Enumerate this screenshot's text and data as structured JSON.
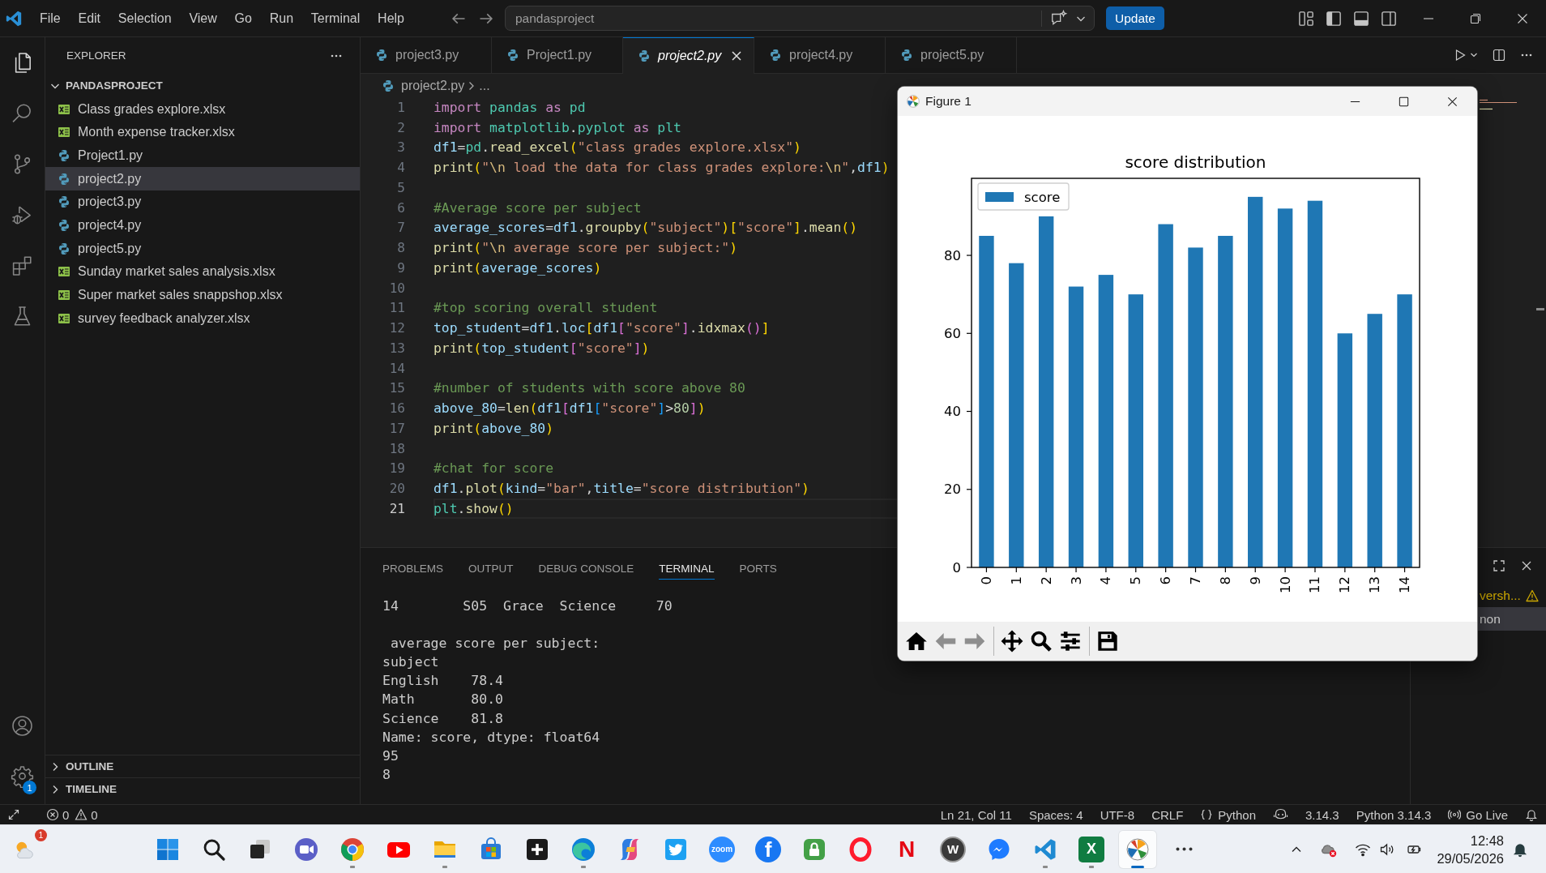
{
  "title_bar": {
    "menu": [
      "File",
      "Edit",
      "Selection",
      "View",
      "Go",
      "Run",
      "Terminal",
      "Help"
    ],
    "search": {
      "value": "pandasproject"
    },
    "update_button": "Update"
  },
  "activity_bar": {
    "items": [
      {
        "kind": "explorer",
        "selected": true
      },
      {
        "kind": "search",
        "selected": false
      },
      {
        "kind": "source-control",
        "selected": false
      },
      {
        "kind": "run-debug",
        "selected": false
      },
      {
        "kind": "extensions",
        "selected": false
      },
      {
        "kind": "testing",
        "selected": false
      }
    ],
    "bottom_items": [
      {
        "kind": "accounts"
      },
      {
        "kind": "manage",
        "badge": "1"
      }
    ]
  },
  "sidebar": {
    "title": "EXPLORER",
    "folder": {
      "name": "PANDASPROJECT",
      "expanded": true,
      "files": [
        {
          "name": "Class grades explore.xlsx",
          "kind": "excel",
          "selected": false
        },
        {
          "name": "Month expense tracker.xlsx",
          "kind": "excel",
          "selected": false
        },
        {
          "name": "Project1.py",
          "kind": "python",
          "selected": false
        },
        {
          "name": "project2.py",
          "kind": "python",
          "selected": true
        },
        {
          "name": "project3.py",
          "kind": "python",
          "selected": false
        },
        {
          "name": "project4.py",
          "kind": "python",
          "selected": false
        },
        {
          "name": "project5.py",
          "kind": "python",
          "selected": false
        },
        {
          "name": "Sunday market sales analysis.xlsx",
          "kind": "excel",
          "selected": false
        },
        {
          "name": "Super market sales snappshop.xlsx",
          "kind": "excel",
          "selected": false
        },
        {
          "name": "survey feedback analyzer.xlsx",
          "kind": "excel",
          "selected": false
        }
      ]
    },
    "sections": [
      {
        "name": "OUTLINE",
        "expanded": false
      },
      {
        "name": "TIMELINE",
        "expanded": false
      }
    ]
  },
  "editor": {
    "tabs": [
      {
        "label": "project3.py",
        "selected": false,
        "preview": false
      },
      {
        "label": "Project1.py",
        "selected": false,
        "preview": false
      },
      {
        "label": "project2.py",
        "selected": true,
        "preview": true
      },
      {
        "label": "project4.py",
        "selected": false,
        "preview": false
      },
      {
        "label": "project5.py",
        "selected": false,
        "preview": false
      }
    ],
    "breadcrumb": [
      "project2.py",
      "..."
    ],
    "lines": [
      {
        "number": "1",
        "current": false,
        "tokens": [
          {
            "kind": "keyword",
            "text": "import "
          },
          {
            "kind": "module",
            "text": "pandas "
          },
          {
            "kind": "keyword",
            "text": "as "
          },
          {
            "kind": "module",
            "text": "pd"
          }
        ]
      },
      {
        "number": "2",
        "current": false,
        "tokens": [
          {
            "kind": "keyword",
            "text": "import "
          },
          {
            "kind": "module",
            "text": "matplotlib"
          },
          {
            "kind": "plain",
            "text": "."
          },
          {
            "kind": "module",
            "text": "pyplot "
          },
          {
            "kind": "keyword",
            "text": "as "
          },
          {
            "kind": "module",
            "text": "plt"
          }
        ]
      },
      {
        "number": "3",
        "current": false,
        "tokens": [
          {
            "kind": "variable",
            "text": "df1"
          },
          {
            "kind": "plain",
            "text": "="
          },
          {
            "kind": "module",
            "text": "pd"
          },
          {
            "kind": "plain",
            "text": "."
          },
          {
            "kind": "function",
            "text": "read_excel"
          },
          {
            "kind": "bracket1",
            "text": "("
          },
          {
            "kind": "string",
            "text": "\"class grades explore.xlsx\""
          },
          {
            "kind": "bracket1",
            "text": ")"
          }
        ]
      },
      {
        "number": "4",
        "current": false,
        "tokens": [
          {
            "kind": "function",
            "text": "print"
          },
          {
            "kind": "bracket1",
            "text": "("
          },
          {
            "kind": "string",
            "text": "\""
          },
          {
            "kind": "escape",
            "text": "\\n"
          },
          {
            "kind": "string",
            "text": " load the data for class grades explore:"
          },
          {
            "kind": "escape",
            "text": "\\n"
          },
          {
            "kind": "string",
            "text": "\""
          },
          {
            "kind": "plain",
            "text": ","
          },
          {
            "kind": "variable",
            "text": "df1"
          },
          {
            "kind": "bracket1",
            "text": ")"
          }
        ]
      },
      {
        "number": "5",
        "current": false
      },
      {
        "number": "6",
        "current": false,
        "tokens": [
          {
            "kind": "comment",
            "text": "#Average score per subject"
          }
        ]
      },
      {
        "number": "7",
        "current": false,
        "tokens": [
          {
            "kind": "variable",
            "text": "average_scores"
          },
          {
            "kind": "plain",
            "text": "="
          },
          {
            "kind": "variable",
            "text": "df1"
          },
          {
            "kind": "plain",
            "text": "."
          },
          {
            "kind": "function",
            "text": "groupby"
          },
          {
            "kind": "bracket1",
            "text": "("
          },
          {
            "kind": "string",
            "text": "\"subject\""
          },
          {
            "kind": "bracket1",
            "text": ")["
          },
          {
            "kind": "string",
            "text": "\"score\""
          },
          {
            "kind": "bracket1",
            "text": "]"
          },
          {
            "kind": "plain",
            "text": "."
          },
          {
            "kind": "function",
            "text": "mean"
          },
          {
            "kind": "bracket1",
            "text": "()"
          }
        ]
      },
      {
        "number": "8",
        "current": false,
        "tokens": [
          {
            "kind": "function",
            "text": "print"
          },
          {
            "kind": "bracket1",
            "text": "("
          },
          {
            "kind": "string",
            "text": "\""
          },
          {
            "kind": "escape",
            "text": "\\n"
          },
          {
            "kind": "string",
            "text": " average score per subject:\""
          },
          {
            "kind": "bracket1",
            "text": ")"
          }
        ]
      },
      {
        "number": "9",
        "current": false,
        "tokens": [
          {
            "kind": "function",
            "text": "print"
          },
          {
            "kind": "bracket1",
            "text": "("
          },
          {
            "kind": "variable",
            "text": "average_scores"
          },
          {
            "kind": "bracket1",
            "text": ")"
          }
        ]
      },
      {
        "number": "10",
        "current": false
      },
      {
        "number": "11",
        "current": false,
        "tokens": [
          {
            "kind": "comment",
            "text": "#top scoring overall student"
          }
        ]
      },
      {
        "number": "12",
        "current": false,
        "tokens": [
          {
            "kind": "variable",
            "text": "top_student"
          },
          {
            "kind": "plain",
            "text": "="
          },
          {
            "kind": "variable",
            "text": "df1"
          },
          {
            "kind": "plain",
            "text": "."
          },
          {
            "kind": "variable",
            "text": "loc"
          },
          {
            "kind": "bracket1",
            "text": "["
          },
          {
            "kind": "variable",
            "text": "df1"
          },
          {
            "kind": "bracket2",
            "text": "["
          },
          {
            "kind": "string",
            "text": "\"score\""
          },
          {
            "kind": "bracket2",
            "text": "]"
          },
          {
            "kind": "plain",
            "text": "."
          },
          {
            "kind": "function",
            "text": "idxmax"
          },
          {
            "kind": "bracket2",
            "text": "()"
          },
          {
            "kind": "bracket1",
            "text": "]"
          }
        ]
      },
      {
        "number": "13",
        "current": false,
        "tokens": [
          {
            "kind": "function",
            "text": "print"
          },
          {
            "kind": "bracket1",
            "text": "("
          },
          {
            "kind": "variable",
            "text": "top_student"
          },
          {
            "kind": "bracket2",
            "text": "["
          },
          {
            "kind": "string",
            "text": "\"score\""
          },
          {
            "kind": "bracket2",
            "text": "]"
          },
          {
            "kind": "bracket1",
            "text": ")"
          }
        ]
      },
      {
        "number": "14",
        "current": false
      },
      {
        "number": "15",
        "current": false,
        "tokens": [
          {
            "kind": "comment",
            "text": "#number of students with score above 80"
          }
        ]
      },
      {
        "number": "16",
        "current": false,
        "tokens": [
          {
            "kind": "variable",
            "text": "above_80"
          },
          {
            "kind": "plain",
            "text": "="
          },
          {
            "kind": "function",
            "text": "len"
          },
          {
            "kind": "bracket1",
            "text": "("
          },
          {
            "kind": "variable",
            "text": "df1"
          },
          {
            "kind": "bracket2",
            "text": "["
          },
          {
            "kind": "variable",
            "text": "df1"
          },
          {
            "kind": "bracket3",
            "text": "["
          },
          {
            "kind": "string",
            "text": "\"score\""
          },
          {
            "kind": "bracket3",
            "text": "]"
          },
          {
            "kind": "plain",
            "text": ">"
          },
          {
            "kind": "number",
            "text": "80"
          },
          {
            "kind": "bracket2",
            "text": "]"
          },
          {
            "kind": "bracket1",
            "text": ")"
          }
        ]
      },
      {
        "number": "17",
        "current": false,
        "tokens": [
          {
            "kind": "function",
            "text": "print"
          },
          {
            "kind": "bracket1",
            "text": "("
          },
          {
            "kind": "variable",
            "text": "above_80"
          },
          {
            "kind": "bracket1",
            "text": ")"
          }
        ]
      },
      {
        "number": "18",
        "current": false
      },
      {
        "number": "19",
        "current": false,
        "tokens": [
          {
            "kind": "comment",
            "text": "#chat for score"
          }
        ]
      },
      {
        "number": "20",
        "current": false,
        "tokens": [
          {
            "kind": "variable",
            "text": "df1"
          },
          {
            "kind": "plain",
            "text": "."
          },
          {
            "kind": "function",
            "text": "plot"
          },
          {
            "kind": "bracket1",
            "text": "("
          },
          {
            "kind": "variable",
            "text": "kind"
          },
          {
            "kind": "plain",
            "text": "="
          },
          {
            "kind": "string",
            "text": "\"bar\""
          },
          {
            "kind": "plain",
            "text": ","
          },
          {
            "kind": "variable",
            "text": "title"
          },
          {
            "kind": "plain",
            "text": "="
          },
          {
            "kind": "string",
            "text": "\"score distribution\""
          },
          {
            "kind": "bracket1",
            "text": ")"
          }
        ]
      },
      {
        "number": "21",
        "current": true,
        "tokens": [
          {
            "kind": "module",
            "text": "plt"
          },
          {
            "kind": "plain",
            "text": "."
          },
          {
            "kind": "function",
            "text": "show"
          },
          {
            "kind": "bracket1",
            "text": "()"
          }
        ]
      }
    ]
  },
  "panel": {
    "tabs": [
      {
        "label": "PROBLEMS",
        "selected": false
      },
      {
        "label": "OUTPUT",
        "selected": false
      },
      {
        "label": "DEBUG CONSOLE",
        "selected": false
      },
      {
        "label": "TERMINAL",
        "selected": true
      },
      {
        "label": "PORTS",
        "selected": false
      }
    ],
    "terminal_blocks": [
      [
        "14        S05  Grace  Science     70"
      ],
      [
        " average score per subject:",
        "subject",
        "English    78.4",
        "Math       80.0",
        "Science    81.8",
        "Name: score, dtype: float64",
        "95",
        "8"
      ]
    ],
    "terminals": [
      {
        "label": "versh...",
        "warning": true,
        "selected": false
      },
      {
        "label": "non",
        "warning": false,
        "selected": true
      }
    ]
  },
  "figure": {
    "title": "Figure 1",
    "chart_data": {
      "type": "bar",
      "title": "score distribution",
      "categories": [
        "0",
        "1",
        "2",
        "3",
        "4",
        "5",
        "6",
        "7",
        "8",
        "9",
        "10",
        "11",
        "12",
        "13",
        "14"
      ],
      "series": [
        {
          "name": "score",
          "color": "#1f77b4",
          "values": [
            85,
            78,
            90,
            72,
            75,
            70,
            88,
            82,
            85,
            95,
            92,
            94,
            60,
            65,
            70
          ]
        }
      ],
      "ylim": [
        0,
        99.75
      ],
      "yticks": [
        0,
        20,
        40,
        60,
        80
      ]
    },
    "toolbar": [
      [
        {
          "kind": "home",
          "disabled": false
        },
        {
          "kind": "back",
          "disabled": true
        },
        {
          "kind": "forward",
          "disabled": true
        }
      ],
      [
        {
          "kind": "move",
          "disabled": false
        },
        {
          "kind": "zoom",
          "disabled": false
        },
        {
          "kind": "configure",
          "disabled": false
        }
      ],
      [
        {
          "kind": "save",
          "disabled": false
        }
      ]
    ]
  },
  "status_bar": {
    "problems": [
      {
        "kind": "error",
        "count": "0"
      },
      {
        "kind": "warning",
        "count": "0"
      }
    ],
    "items": [
      {
        "kind": "text",
        "label": "Ln 21, Col 11"
      },
      {
        "kind": "text",
        "label": "Spaces: 4"
      },
      {
        "kind": "text",
        "label": "UTF-8"
      },
      {
        "kind": "text",
        "label": "CRLF"
      },
      {
        "kind": "language",
        "label": "Python"
      },
      {
        "kind": "copilot"
      },
      {
        "kind": "text",
        "label": "3.14.3"
      },
      {
        "kind": "text",
        "label": "Python 3.14.3"
      },
      {
        "kind": "live",
        "label": "Go Live"
      },
      {
        "kind": "bell"
      }
    ]
  },
  "taskbar": {
    "weather": {
      "badge": "1"
    },
    "apps": [
      {
        "kind": "windows",
        "running": false,
        "selected": false
      },
      {
        "kind": "search",
        "running": false,
        "selected": false
      },
      {
        "kind": "task-view",
        "running": false,
        "selected": false
      },
      {
        "kind": "video-call",
        "running": false,
        "selected": false
      },
      {
        "kind": "chrome",
        "running": true,
        "selected": false
      },
      {
        "kind": "youtube",
        "running": false,
        "selected": false
      },
      {
        "kind": "folder",
        "running": true,
        "selected": false
      },
      {
        "kind": "store",
        "running": false,
        "selected": false
      },
      {
        "kind": "plus-tile",
        "running": false,
        "selected": false
      },
      {
        "kind": "edge",
        "running": true,
        "selected": false
      },
      {
        "kind": "copilot",
        "running": false,
        "selected": false
      },
      {
        "kind": "twitter",
        "running": false,
        "selected": false
      },
      {
        "kind": "zoom",
        "glyph": "zoom",
        "running": false,
        "selected": false
      },
      {
        "kind": "facebook",
        "glyph": "f",
        "running": false,
        "selected": false
      },
      {
        "kind": "lock",
        "running": false,
        "selected": false
      },
      {
        "kind": "opera",
        "running": false,
        "selected": false
      },
      {
        "kind": "netflix",
        "glyph": "N",
        "running": false,
        "selected": false
      },
      {
        "kind": "w-circle",
        "glyph": "W",
        "running": false,
        "selected": false
      },
      {
        "kind": "messenger",
        "running": false,
        "selected": false
      },
      {
        "kind": "vscode",
        "running": true,
        "selected": false
      },
      {
        "kind": "excel",
        "glyph": "X",
        "running": true,
        "selected": false
      },
      {
        "kind": "matplotlib",
        "running": true,
        "selected": true
      },
      {
        "kind": "more",
        "running": false,
        "selected": false
      }
    ],
    "tray": [
      {
        "kind": "chevron-up"
      },
      {
        "kind": "cloud"
      },
      {
        "kind": "wifi"
      },
      {
        "kind": "speaker"
      },
      {
        "kind": "battery"
      }
    ],
    "time": "12:48",
    "date": "29/05/2026"
  }
}
